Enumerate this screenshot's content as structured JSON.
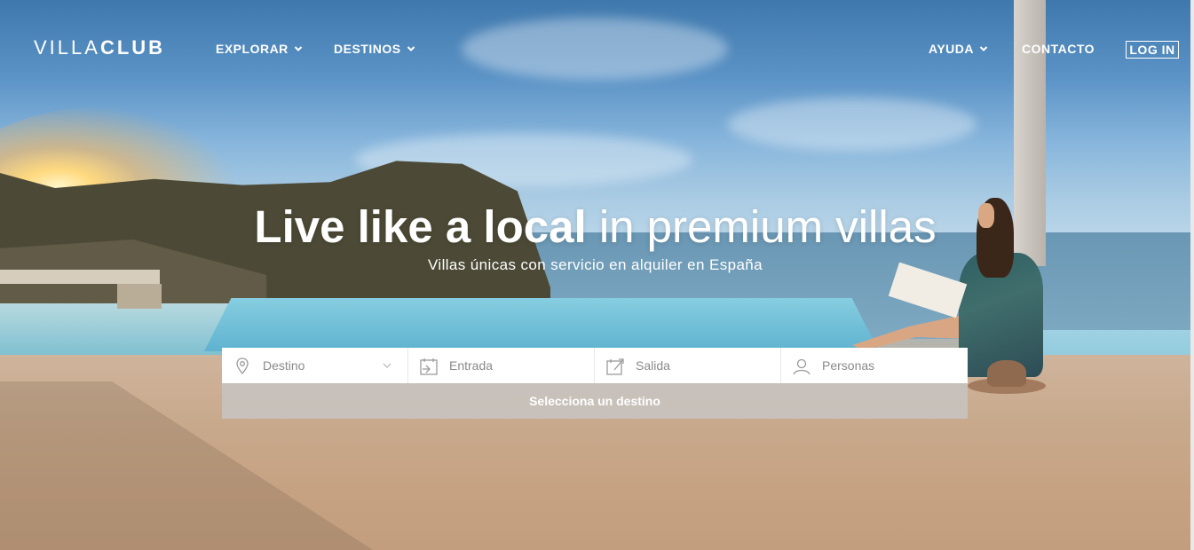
{
  "brand": {
    "logo_light": "VILLA",
    "logo_bold": "CLUB"
  },
  "nav": {
    "left": [
      {
        "label": "EXPLORAR",
        "has_dropdown": true
      },
      {
        "label": "DESTINOS",
        "has_dropdown": true
      }
    ],
    "right": [
      {
        "label": "AYUDA",
        "has_dropdown": true
      },
      {
        "label": "CONTACTO",
        "has_dropdown": false
      }
    ],
    "login": "LOG IN"
  },
  "hero": {
    "headline_bold": "Live like a local",
    "headline_regular": "in premium villas",
    "subheadline": "Villas únicas con servicio en alquiler en España"
  },
  "search": {
    "fields": [
      {
        "icon": "map-pin-icon",
        "placeholder": "Destino",
        "has_dropdown": true
      },
      {
        "icon": "calendar-in-icon",
        "placeholder": "Entrada"
      },
      {
        "icon": "calendar-out-icon",
        "placeholder": "Salida"
      },
      {
        "icon": "user-icon",
        "placeholder": "Personas"
      }
    ],
    "submit_label": "Selecciona un destino"
  },
  "colors": {
    "text_white": "#ffffff",
    "field_text": "#8a8a8a",
    "cta_bg": "#c8c2be"
  }
}
